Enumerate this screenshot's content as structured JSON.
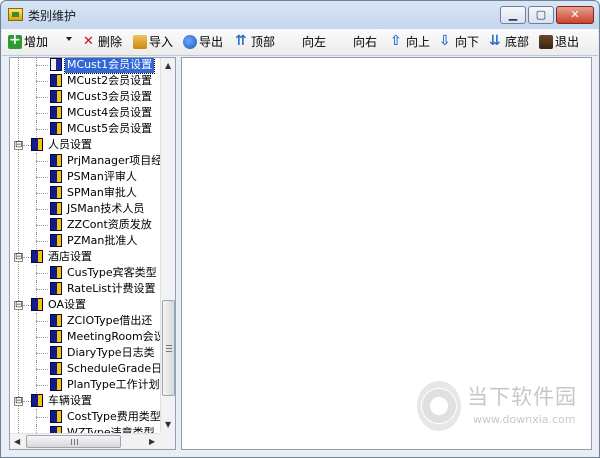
{
  "window": {
    "title": "类别维护",
    "buttons": {
      "minimize": "▁",
      "maximize": "▢",
      "close": "✕"
    }
  },
  "toolbar": {
    "items": [
      {
        "id": "add",
        "label": "增加",
        "icon": "add-icon",
        "dropdown": true
      },
      {
        "id": "delete",
        "label": "删除",
        "icon": "delete-icon"
      },
      {
        "id": "import",
        "label": "导入",
        "icon": "import-icon"
      },
      {
        "id": "export",
        "label": "导出",
        "icon": "export-icon"
      },
      {
        "id": "top",
        "label": "顶部",
        "icon": "top-icon"
      },
      {
        "id": "left",
        "label": "向左"
      },
      {
        "id": "right",
        "label": "向右"
      },
      {
        "id": "up",
        "label": "向上",
        "icon": "up-icon"
      },
      {
        "id": "down",
        "label": "向下",
        "icon": "down-icon"
      },
      {
        "id": "bottom",
        "label": "底部",
        "icon": "bottom-icon"
      },
      {
        "id": "exit",
        "label": "退出",
        "icon": "exit-icon"
      }
    ]
  },
  "tree": {
    "nodes": [
      {
        "label": "MCust1会员设置",
        "level": 2,
        "selected": true,
        "icon": "open-book-icon"
      },
      {
        "label": "MCust2会员设置",
        "level": 2
      },
      {
        "label": "MCust3会员设置",
        "level": 2
      },
      {
        "label": "MCust4会员设置",
        "level": 2
      },
      {
        "label": "MCust5会员设置",
        "level": 2
      },
      {
        "label": "人员设置",
        "level": 1,
        "expander": "⊟"
      },
      {
        "label": "PrjManager项目经",
        "level": 2
      },
      {
        "label": "PSMan评审人",
        "level": 2
      },
      {
        "label": "SPMan审批人",
        "level": 2
      },
      {
        "label": "JSMan技术人员",
        "level": 2
      },
      {
        "label": "ZZCont资质发放",
        "level": 2
      },
      {
        "label": "PZMan批准人",
        "level": 2
      },
      {
        "label": "酒店设置",
        "level": 1,
        "expander": "⊟"
      },
      {
        "label": "CusType宾客类型",
        "level": 2
      },
      {
        "label": "RateList计费设置",
        "level": 2
      },
      {
        "label": "OA设置",
        "level": 1,
        "expander": "⊟"
      },
      {
        "label": "ZCIOType借出还",
        "level": 2
      },
      {
        "label": "MeetingRoom会议",
        "level": 2
      },
      {
        "label": "DiaryType日志类",
        "level": 2
      },
      {
        "label": "ScheduleGrade日",
        "level": 2
      },
      {
        "label": "PlanType工作计划",
        "level": 2
      },
      {
        "label": "车辆设置",
        "level": 1,
        "expander": "⊟"
      },
      {
        "label": "CostType费用类型",
        "level": 2
      },
      {
        "label": "WZType违章类型",
        "level": 2
      }
    ]
  },
  "scroll": {
    "up": "▲",
    "down": "▼",
    "left": "◀",
    "right": "▶"
  },
  "watermark": {
    "title": "当下软件园",
    "url": "www.downxia.com"
  }
}
